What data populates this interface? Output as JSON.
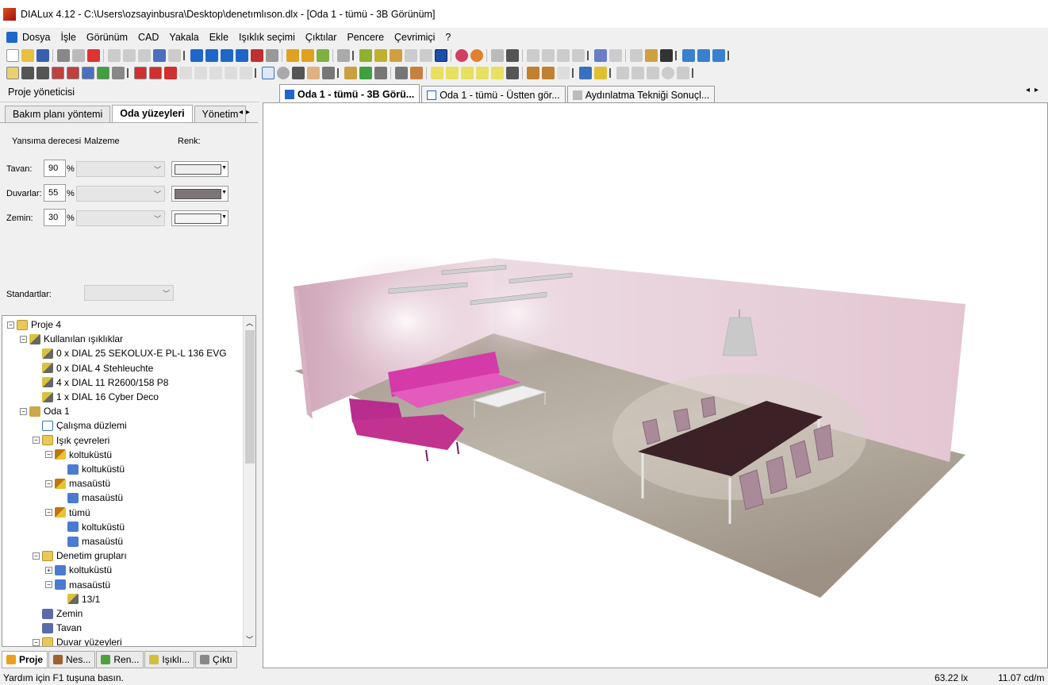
{
  "title_bar": {
    "title": "DIALux 4.12 - C:\\Users\\ozsayinbusra\\Desktop\\denetımlıson.dlx - [Oda 1 - tümü - 3B Görünüm]"
  },
  "menu": {
    "items": [
      "Dosya",
      "İşle",
      "Görünüm",
      "CAD",
      "Yakala",
      "Ekle",
      "Işıklık seçimi",
      "Çıktılar",
      "Pencere",
      "Çevrimiçi",
      "?"
    ]
  },
  "project_manager": {
    "header": "Proje yöneticisi",
    "tabs": [
      "Bakım planı yöntemi",
      "Oda yüzeyleri",
      "Yönetim"
    ],
    "active_tab": "Oda yüzeyleri",
    "columns": {
      "reflectance": "Yansıma derecesi",
      "material": "Malzeme",
      "color": "Renk:"
    },
    "surfaces": [
      {
        "label": "Tavan:",
        "value": "90",
        "unit": "%",
        "color": "#eeeeee"
      },
      {
        "label": "Duvarlar:",
        "value": "55",
        "unit": "%",
        "color": "#7d7478"
      },
      {
        "label": "Zemin:",
        "value": "30",
        "unit": "%",
        "color": "#f4f4f4"
      }
    ],
    "standards_label": "Standartlar:"
  },
  "tree": [
    {
      "label": "Proje 4",
      "level": 0,
      "icon": "folder-icon",
      "pm": "−"
    },
    {
      "label": "Kullanılan ışıklıklar",
      "level": 1,
      "icon": "luminaires-icon",
      "pm": "−"
    },
    {
      "label": "0 x DIAL 25 SEKOLUX-E PL-L 136 EVG",
      "level": 2,
      "icon": "lamp-icon"
    },
    {
      "label": "0 x DIAL 4 Stehleuchte",
      "level": 2,
      "icon": "lamp-icon"
    },
    {
      "label": "4 x DIAL 11 R2600/158 P8",
      "level": 2,
      "icon": "lamp-icon"
    },
    {
      "label": "1 x DIAL 16 Cyber Deco",
      "level": 2,
      "icon": "lamp-icon"
    },
    {
      "label": "Oda 1",
      "level": 1,
      "icon": "room-icon",
      "pm": "−"
    },
    {
      "label": "Çalışma düzlemi",
      "level": 2,
      "icon": "workplane-icon"
    },
    {
      "label": "Işık çevreleri",
      "level": 2,
      "icon": "folder-icon",
      "pm": "−"
    },
    {
      "label": "koltuküstü",
      "level": 3,
      "icon": "light-scene-icon",
      "pm": "−"
    },
    {
      "label": "koltuküstü",
      "level": 4,
      "icon": "control-group-icon"
    },
    {
      "label": "masaüstü",
      "level": 3,
      "icon": "light-scene-icon",
      "pm": "−"
    },
    {
      "label": "masaüstü",
      "level": 4,
      "icon": "control-group-icon"
    },
    {
      "label": "tümü",
      "level": 3,
      "icon": "light-scene-icon",
      "pm": "−"
    },
    {
      "label": "koltuküstü",
      "level": 4,
      "icon": "control-group-icon"
    },
    {
      "label": "masaüstü",
      "level": 4,
      "icon": "control-group-icon"
    },
    {
      "label": "Denetim grupları",
      "level": 2,
      "icon": "folder-icon",
      "pm": "−"
    },
    {
      "label": "koltuküstü",
      "level": 3,
      "icon": "control-group-icon",
      "pm": "+"
    },
    {
      "label": "masaüstü",
      "level": 3,
      "icon": "control-group-icon",
      "pm": "−"
    },
    {
      "label": "13/1",
      "level": 4,
      "icon": "lamp-icon"
    },
    {
      "label": "Zemin",
      "level": 2,
      "icon": "surface-icon"
    },
    {
      "label": "Tavan",
      "level": 2,
      "icon": "surface-icon"
    },
    {
      "label": "Duvar yüzeyleri",
      "level": 2,
      "icon": "folder-icon",
      "pm": "−"
    }
  ],
  "bottom_tabs": [
    {
      "label": "Proje",
      "active": true
    },
    {
      "label": "Nes...",
      "active": false
    },
    {
      "label": "Ren...",
      "active": false
    },
    {
      "label": "Işıklı...",
      "active": false
    },
    {
      "label": "Çıktı",
      "active": false
    }
  ],
  "document_tabs": [
    {
      "label": "Oda 1 - tümü - 3B Görü...",
      "active": true
    },
    {
      "label": "Oda 1 - tümü - Üstten gör...",
      "active": false
    },
    {
      "label": "Aydınlatma Tekniği Sonuçl...",
      "active": false
    }
  ],
  "status": {
    "help": "Yardım için F1 tuşuna basın.",
    "illuminance": "63.22 lx",
    "luminance": "11.07 cd/m"
  }
}
